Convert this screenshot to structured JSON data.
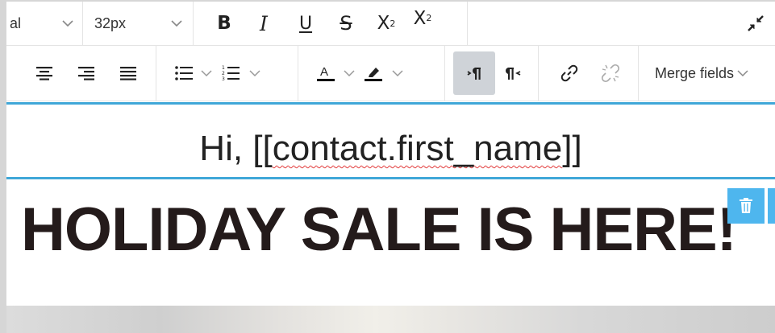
{
  "toolbar": {
    "font_family_value": "al",
    "font_size_value": "32px",
    "bold_label": "B",
    "italic_label": "I",
    "underline_label": "U",
    "strike_label": "S",
    "superscript_base": "X",
    "superscript_mark": "2",
    "subscript_base": "X",
    "subscript_mark": "2",
    "merge_fields_label": "Merge fields",
    "icons": [
      "chevron-down-icon",
      "collapse-icon",
      "align-center-icon",
      "align-right-icon",
      "align-justify-icon",
      "bullet-list-icon",
      "numbered-list-icon",
      "text-color-icon",
      "highlight-icon",
      "ltr-icon",
      "rtl-icon",
      "link-icon",
      "unlink-icon",
      "trash-icon"
    ]
  },
  "content": {
    "greeting_prefix": "Hi, [[",
    "greeting_tag": "contact.first_name",
    "greeting_suffix": "]]",
    "headline": "HOLIDAY SALE IS HERE!"
  },
  "colors": {
    "accent": "#3fa7d8",
    "delete_button": "#4eb6ee",
    "active_button": "#cfd3d8",
    "text_color_underline": "#000000",
    "headline": "#241b1b"
  }
}
